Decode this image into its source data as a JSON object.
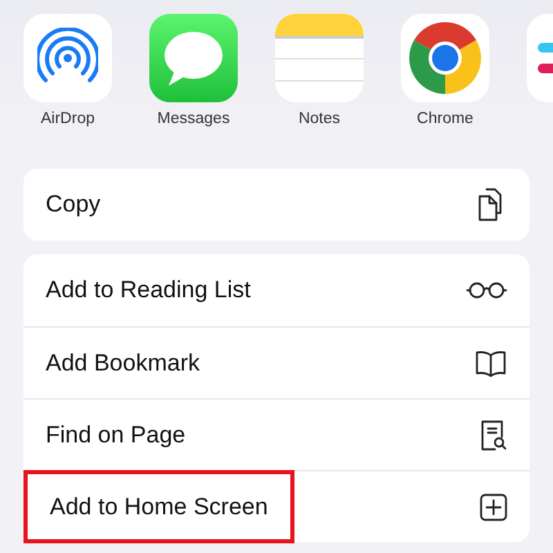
{
  "apps": [
    {
      "kind": "airdrop",
      "label": "AirDrop"
    },
    {
      "kind": "messages",
      "label": "Messages"
    },
    {
      "kind": "notes",
      "label": "Notes"
    },
    {
      "kind": "chrome",
      "label": "Chrome"
    },
    {
      "kind": "slack"
    }
  ],
  "action_groups": [
    [
      {
        "label": "Copy",
        "kind": "copy",
        "highlighted": false
      }
    ],
    [
      {
        "label": "Add to Reading List",
        "kind": "glasses",
        "highlighted": false
      },
      {
        "label": "Add Bookmark",
        "kind": "book",
        "highlighted": false
      },
      {
        "label": "Find on Page",
        "kind": "find",
        "highlighted": false
      },
      {
        "label": "Add to Home Screen",
        "kind": "add",
        "highlighted": true
      }
    ]
  ]
}
